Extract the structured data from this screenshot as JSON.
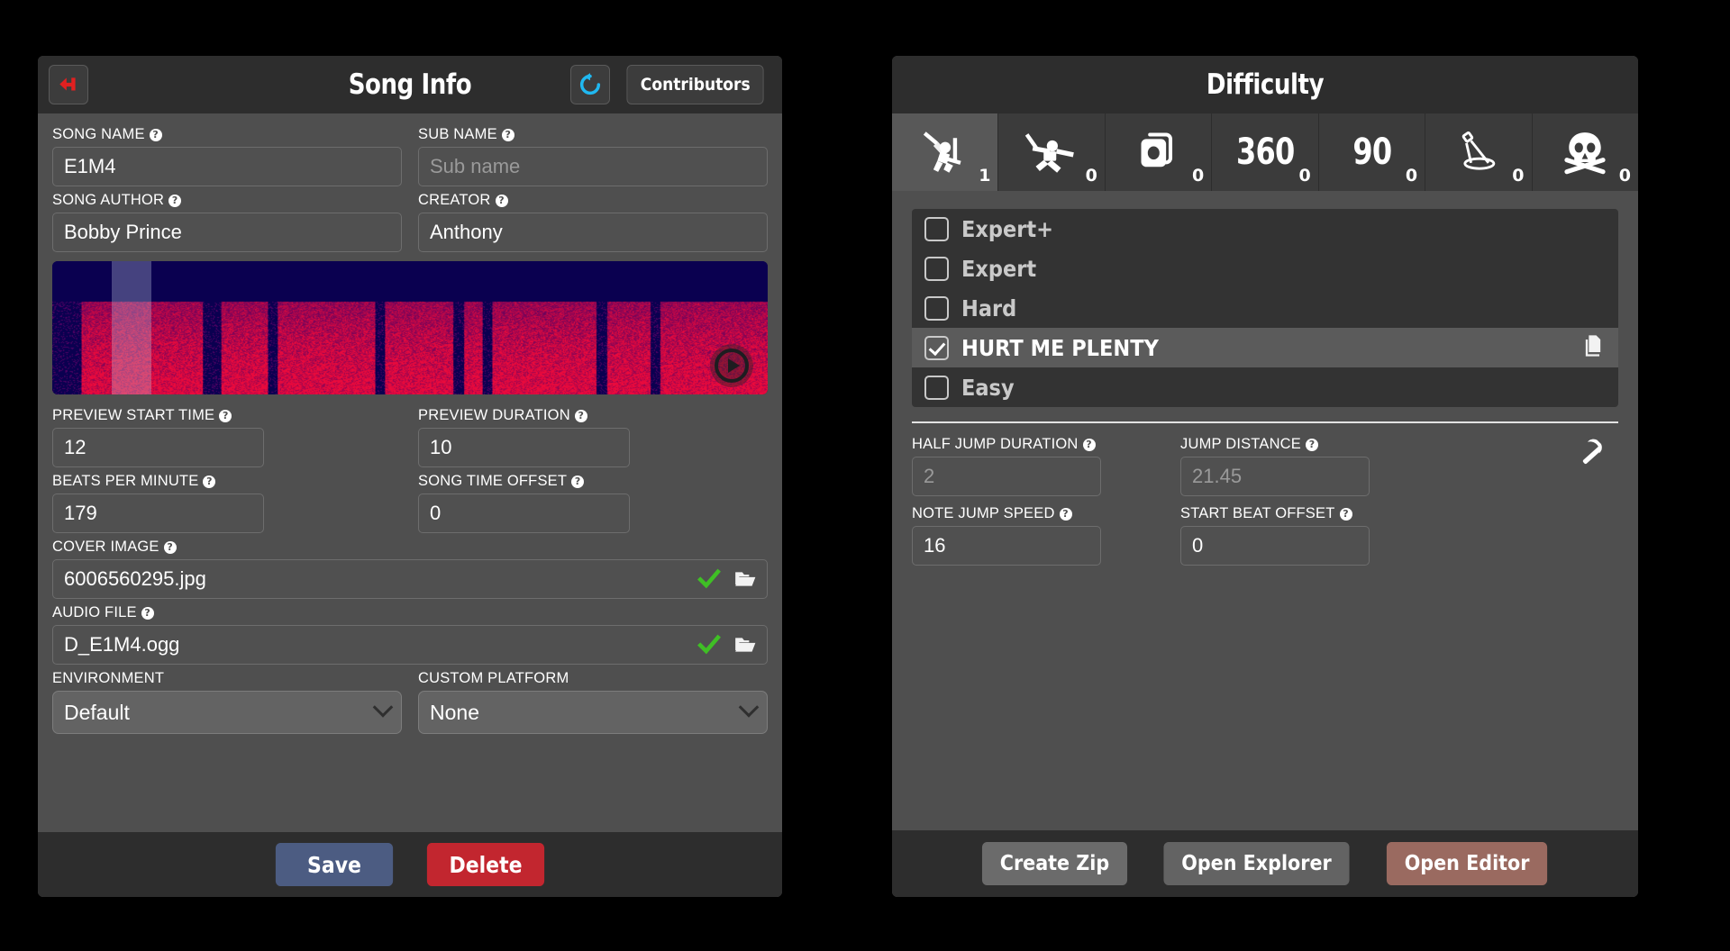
{
  "song_info": {
    "title": "Song Info",
    "back_icon": "back-arrow-icon",
    "reset_icon": "reset-icon",
    "contributors_label": "Contributors",
    "fields": {
      "song_name": {
        "label": "SONG NAME",
        "value": "E1M4",
        "placeholder": ""
      },
      "sub_name": {
        "label": "SUB NAME",
        "value": "",
        "placeholder": "Sub name"
      },
      "song_author": {
        "label": "SONG AUTHOR",
        "value": "Bobby Prince",
        "placeholder": ""
      },
      "creator": {
        "label": "CREATOR",
        "value": "Anthony",
        "placeholder": ""
      },
      "preview_start_time": {
        "label": "PREVIEW START TIME",
        "value": "12"
      },
      "preview_duration": {
        "label": "PREVIEW DURATION",
        "value": "10"
      },
      "beats_per_minute": {
        "label": "BEATS PER MINUTE",
        "value": "179"
      },
      "song_time_offset": {
        "label": "SONG TIME OFFSET",
        "value": "0"
      },
      "cover_image": {
        "label": "COVER IMAGE",
        "value": "6006560295.jpg"
      },
      "audio_file": {
        "label": "AUDIO FILE",
        "value": "D_E1M4.ogg"
      },
      "environment": {
        "label": "ENVIRONMENT",
        "value": "Default"
      },
      "custom_platform": {
        "label": "CUSTOM PLATFORM",
        "value": "None"
      }
    },
    "waveform": {
      "play_icon": "play-icon",
      "selection_start_pct": 8.3,
      "selection_width_pct": 5.6
    },
    "buttons": {
      "save_label": "Save",
      "delete_label": "Delete"
    }
  },
  "difficulty": {
    "title": "Difficulty",
    "modes": [
      {
        "name": "standard",
        "icon": "standard-saber-icon",
        "count": "1",
        "active": true
      },
      {
        "name": "no-arrows",
        "icon": "no-arrows-icon",
        "count": "0",
        "active": false
      },
      {
        "name": "one-saber",
        "icon": "one-saber-icon",
        "count": "0",
        "active": false
      },
      {
        "name": "360-degree",
        "icon": "360-text-icon",
        "label": "360",
        "count": "0",
        "active": false
      },
      {
        "name": "90-degree",
        "icon": "90-text-icon",
        "label": "90",
        "count": "0",
        "active": false
      },
      {
        "name": "lightshow",
        "icon": "spotlight-icon",
        "count": "0",
        "active": false
      },
      {
        "name": "lawless",
        "icon": "skull-crossbones-icon",
        "count": "0",
        "active": false
      }
    ],
    "levels": [
      {
        "label": "Expert+",
        "checked": false,
        "selected": false
      },
      {
        "label": "Expert",
        "checked": false,
        "selected": false
      },
      {
        "label": "Hard",
        "checked": false,
        "selected": false
      },
      {
        "label": "HURT ME PLENTY",
        "checked": true,
        "selected": true
      },
      {
        "label": "Easy",
        "checked": false,
        "selected": false
      }
    ],
    "copy_icon": "copy-icon",
    "pickaxe_icon": "pickaxe-icon",
    "fields": {
      "half_jump_duration": {
        "label": "HALF JUMP DURATION",
        "value": "2",
        "readonly": true
      },
      "jump_distance": {
        "label": "JUMP DISTANCE",
        "value": "21.45",
        "readonly": true
      },
      "note_jump_speed": {
        "label": "NOTE JUMP SPEED",
        "value": "16",
        "readonly": false
      },
      "start_beat_offset": {
        "label": "START BEAT OFFSET",
        "value": "0",
        "readonly": false
      }
    },
    "buttons": {
      "create_zip_label": "Create Zip",
      "open_explorer_label": "Open Explorer",
      "open_editor_label": "Open Editor"
    }
  },
  "colors": {
    "panel_bg": "#4f4f4f",
    "header_bg": "#2d2d2d",
    "save_blue": "#4c5c82",
    "delete_red": "#c2262f",
    "open_editor_brown": "#9a6a60",
    "check_green": "#3fbf25",
    "reset_cyan": "#20b8f0",
    "back_red": "#e02020"
  }
}
